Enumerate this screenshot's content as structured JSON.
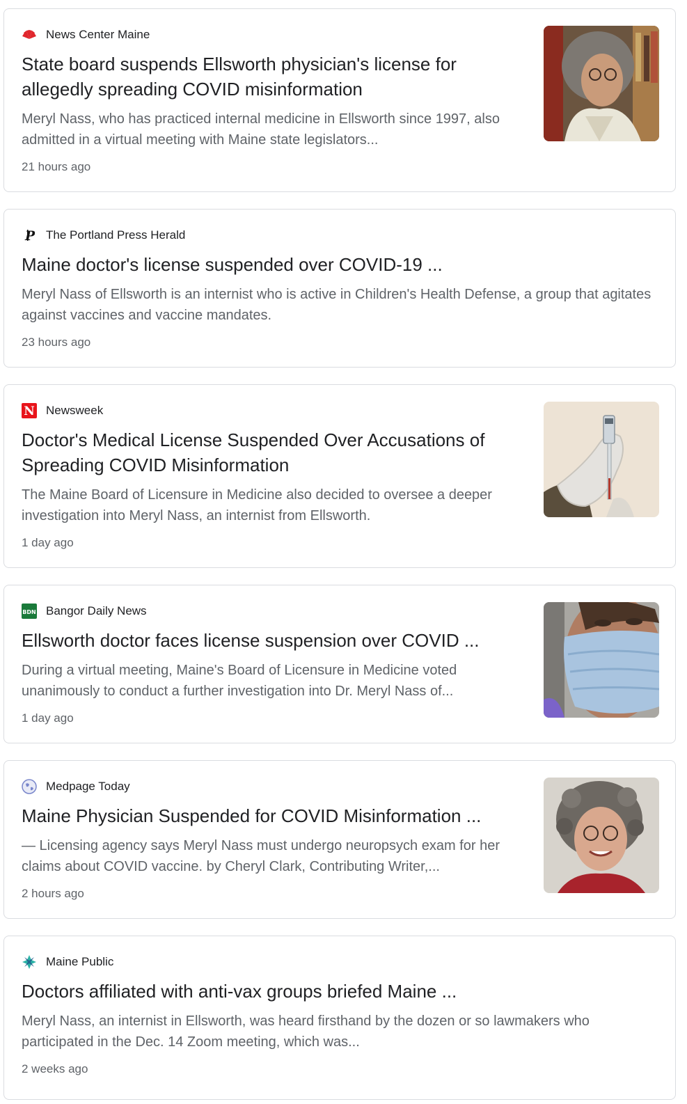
{
  "articles": [
    {
      "source": "News Center Maine",
      "source_icon": "nbc-peacock-icon",
      "title": "State board suspends Ellsworth physician's license for allegedly spreading COVID misinformation",
      "snippet": "Meryl Nass, who has practiced internal medicine in Ellsworth since 1997, also admitted in a virtual meeting with Maine state legislators...",
      "time": "21 hours ago",
      "thumbnail": "photo-woman-gray-curly-hair"
    },
    {
      "source": "The Portland Press Herald",
      "source_icon": "press-herald-p-icon",
      "title": "Maine doctor's license suspended over COVID-19 ...",
      "snippet": "Meryl Nass of Ellsworth is an internist who is active in Children's Health Defense, a group that agitates against vaccines and vaccine mandates.",
      "time": "23 hours ago"
    },
    {
      "source": "Newsweek",
      "source_icon": "newsweek-n-icon",
      "title": "Doctor's Medical License Suspended Over Accusations of Spreading COVID Misinformation",
      "snippet": "The Maine Board of Licensure in Medicine also decided to oversee a deeper investigation into Meryl Nass, an internist from Ellsworth.",
      "time": "1 day ago",
      "thumbnail": "photo-gloved-hand-vaccine-vial"
    },
    {
      "source": "Bangor Daily News",
      "source_icon": "bdn-icon",
      "title": "Ellsworth doctor faces license suspension over COVID ...",
      "snippet": "During a virtual meeting, Maine's Board of Licensure in Medicine voted unanimously to conduct a further investigation into Dr. Meryl Nass of...",
      "time": "1 day ago",
      "thumbnail": "photo-person-blue-face-mask"
    },
    {
      "source": "Medpage Today",
      "source_icon": "globe-icon",
      "title": "Maine Physician Suspended for COVID Misinformation ...",
      "snippet": "— Licensing agency says Meryl Nass must undergo neuropsych exam for her claims about COVID vaccine. by Cheryl Clark, Contributing Writer,...",
      "time": "2 hours ago",
      "thumbnail": "photo-smiling-woman-glasses"
    },
    {
      "source": "Maine Public",
      "source_icon": "maine-public-icon",
      "title": "Doctors affiliated with anti-vax groups briefed Maine ...",
      "snippet": "Meryl Nass, an internist in Ellsworth, was heard firsthand by the dozen or so lawmakers who participated in the Dec. 14 Zoom meeting, which was...",
      "time": "2 weeks ago"
    }
  ],
  "colors": {
    "border": "#dadce0",
    "title": "#202124",
    "snippet": "#5f6368",
    "nbc_red": "#e0262c",
    "newsweek_red": "#e8141b",
    "bdn_green": "#1a7a3a"
  }
}
